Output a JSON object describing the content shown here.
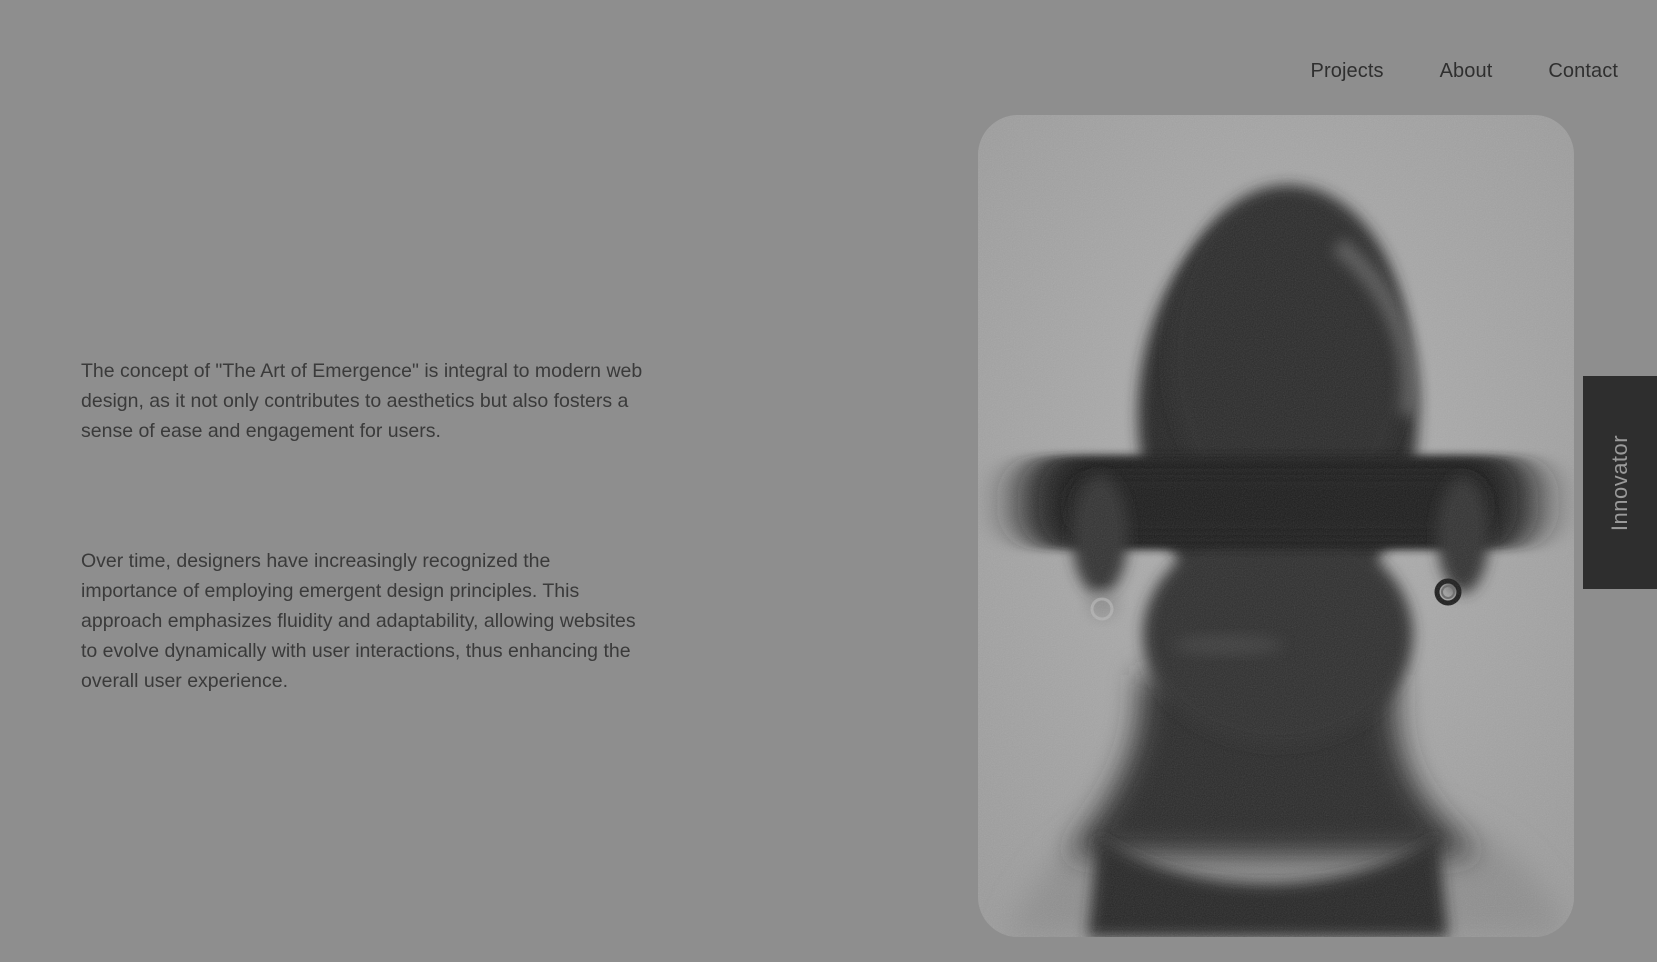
{
  "nav": {
    "items": [
      "Projects",
      "About",
      "Contact"
    ]
  },
  "content": {
    "paragraph_1": "The concept of \"The Art of Emergence\" is integral to modern web design, as it not only contributes to aesthetics but also fosters a sense of ease and engagement for users.",
    "paragraph_2": "Over time, designers have increasingly recognized the importance of employing emergent design principles. This approach emphasizes fluidity and adaptability, allowing websites to evolve dynamically with user interactions, thus enhancing the overall user experience."
  },
  "side_tab": {
    "label": "Innovator"
  },
  "colors": {
    "background": "#8e8e8e",
    "text": "#333333",
    "side_tab_bg": "#2e2e2e",
    "side_tab_text": "#9a9a9a",
    "portrait_bg": "#a4a4a4"
  }
}
